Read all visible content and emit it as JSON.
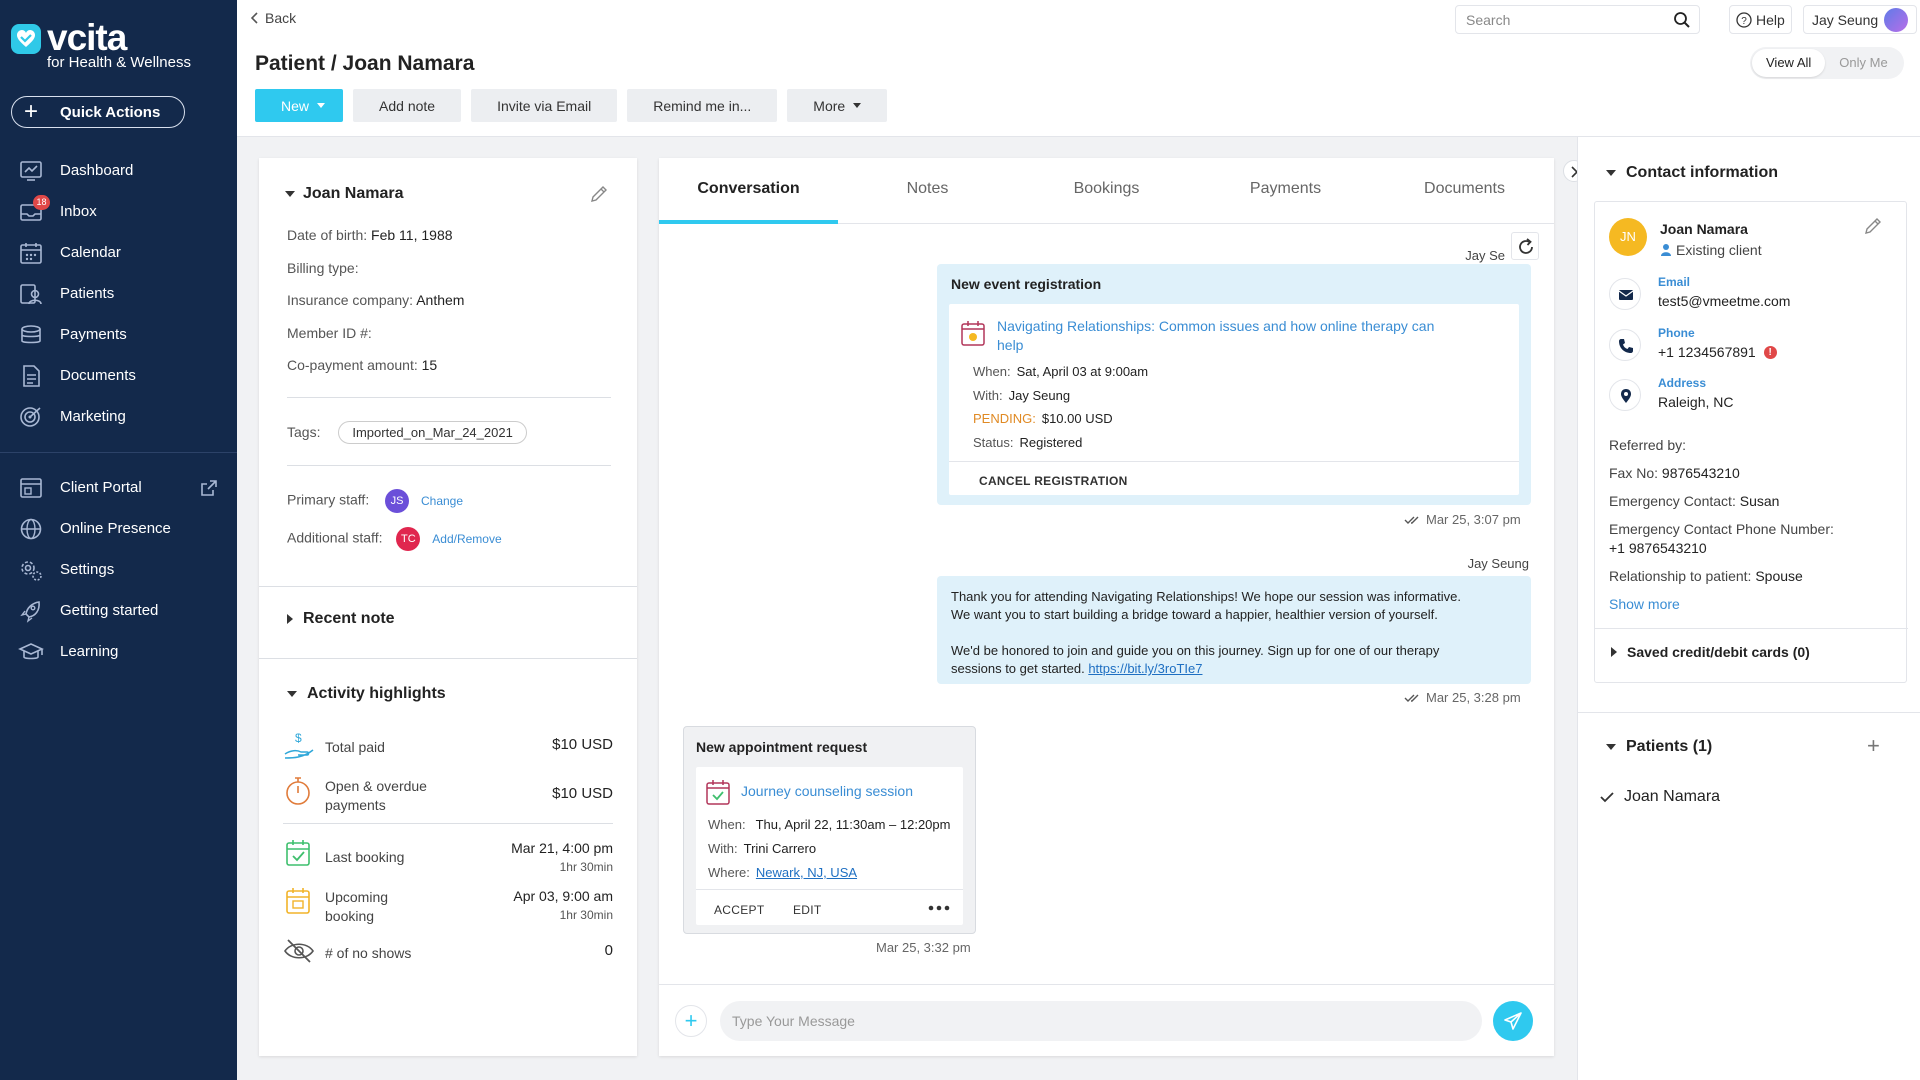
{
  "brand": {
    "name": "vcita",
    "subtitle": "for Health & Wellness"
  },
  "sidebar": {
    "quick_actions": "Quick Actions",
    "inbox_badge": "18",
    "items": [
      {
        "label": "Dashboard",
        "icon": "dashboard-icon"
      },
      {
        "label": "Inbox",
        "icon": "inbox-icon"
      },
      {
        "label": "Calendar",
        "icon": "calendar-icon"
      },
      {
        "label": "Patients",
        "icon": "patients-icon"
      },
      {
        "label": "Payments",
        "icon": "payments-icon"
      },
      {
        "label": "Documents",
        "icon": "documents-icon"
      },
      {
        "label": "Marketing",
        "icon": "marketing-icon"
      }
    ],
    "items2": [
      {
        "label": "Client Portal",
        "icon": "client-portal-icon"
      },
      {
        "label": "Online Presence",
        "icon": "globe-icon"
      },
      {
        "label": "Settings",
        "icon": "gear-icon"
      },
      {
        "label": "Getting started",
        "icon": "rocket-icon"
      },
      {
        "label": "Learning",
        "icon": "graduation-cap-icon"
      }
    ]
  },
  "header": {
    "back": "Back",
    "title": "Patient / Joan Namara",
    "search_placeholder": "Search",
    "help": "Help",
    "user": "Jay Seung",
    "view_all": "View All",
    "only_me": "Only Me",
    "toolbar": {
      "new": "New",
      "add_note": "Add note",
      "invite": "Invite via Email",
      "remind": "Remind me in...",
      "more": "More"
    }
  },
  "patient": {
    "name": "Joan Namara",
    "fields": [
      {
        "label": "Date of birth:",
        "value": "Feb 11, 1988"
      },
      {
        "label": "Billing type:",
        "value": ""
      },
      {
        "label": "Insurance company:",
        "value": "Anthem"
      },
      {
        "label": "Member ID #:",
        "value": ""
      },
      {
        "label": "Co-payment amount:",
        "value": "15"
      }
    ],
    "tags_label": "Tags:",
    "tag": "Imported_on_Mar_24_2021",
    "primary_staff_label": "Primary staff:",
    "primary_staff_initials": "JS",
    "change": "Change",
    "additional_staff_label": "Additional staff:",
    "additional_staff_initials": "TC",
    "add_remove": "Add/Remove",
    "recent_note": "Recent note",
    "activity_title": "Activity highlights",
    "activity": {
      "total_paid_label": "Total paid",
      "total_paid": "$10 USD",
      "open_label_1": "Open & overdue",
      "open_label_2": "payments",
      "open": "$10 USD",
      "last_booking_label": "Last booking",
      "last_booking": "Mar 21, 4:00 pm",
      "last_booking_dur": "1hr 30min",
      "upcoming_label_1": "Upcoming",
      "upcoming_label_2": "booking",
      "upcoming": "Apr 03, 9:00 am",
      "upcoming_dur": "1hr 30min",
      "no_shows_label": "# of no shows",
      "no_shows": "0"
    }
  },
  "tabs": [
    "Conversation",
    "Notes",
    "Bookings",
    "Payments",
    "Documents"
  ],
  "conversation": {
    "msg1": {
      "sender": "Jay Se",
      "title": "New event registration",
      "event_title_1": "Navigating Relationships: Common issues and how online therapy can",
      "event_title_2": "help",
      "when_label": "When:",
      "when": "Sat, April 03 at 9:00am",
      "with_label": "With:",
      "with": "Jay Seung",
      "pending_label": "PENDING:",
      "pending": "$10.00 USD",
      "status_label": "Status:",
      "status": "Registered",
      "cancel": "CANCEL REGISTRATION",
      "time": "Mar 25, 3:07 pm"
    },
    "msg2": {
      "sender": "Jay Seung",
      "p1_l1": "Thank you for attending Navigating Relationships! We hope our session was informative.",
      "p1_l2": "We want you to start building a bridge toward a happier, healthier version of yourself.",
      "p2_l1": "We'd be honored to join and guide you on this journey. Sign up for one of our therapy",
      "p2_l2": "sessions to get started.",
      "link": "https://bit.ly/3roTIe7",
      "time": "Mar 25, 3:28 pm"
    },
    "msg3": {
      "title": "New appointment request",
      "appt_title": "Journey counseling session",
      "when_label": "When:",
      "when": "Thu, April 22, 11:30am – 12:20pm",
      "with_label": "With:",
      "with": "Trini Carrero",
      "where_label": "Where:",
      "where": "Newark, NJ, USA",
      "accept": "ACCEPT",
      "edit": "EDIT",
      "time": "Mar 25, 3:32 pm"
    },
    "compose_placeholder": "Type Your Message"
  },
  "contact": {
    "title": "Contact information",
    "initials": "JN",
    "name": "Joan Namara",
    "status": "Existing client",
    "email_label": "Email",
    "email": "test5@vmeetme.com",
    "phone_label": "Phone",
    "phone": "+1 1234567891",
    "address_label": "Address",
    "address": "Raleigh, NC",
    "referred_label": "Referred by:",
    "fax_label": "Fax No:",
    "fax": "9876543210",
    "emergency_label": "Emergency Contact:",
    "emergency": "Susan",
    "emergency_phone_label": "Emergency Contact Phone Number:",
    "emergency_phone": "+1 9876543210",
    "relationship_label": "Relationship to patient:",
    "relationship": "Spouse",
    "show_more": "Show more",
    "saved_cards": "Saved credit/debit cards (0)"
  },
  "patients_section": {
    "title": "Patients (1)",
    "items": [
      "Joan Namara"
    ]
  },
  "colors": {
    "sidebar": "#13294b",
    "accent": "#2fc9ef",
    "link": "#3a8dd4",
    "pending": "#e08a24",
    "avatar_jn": "#f5b922"
  }
}
